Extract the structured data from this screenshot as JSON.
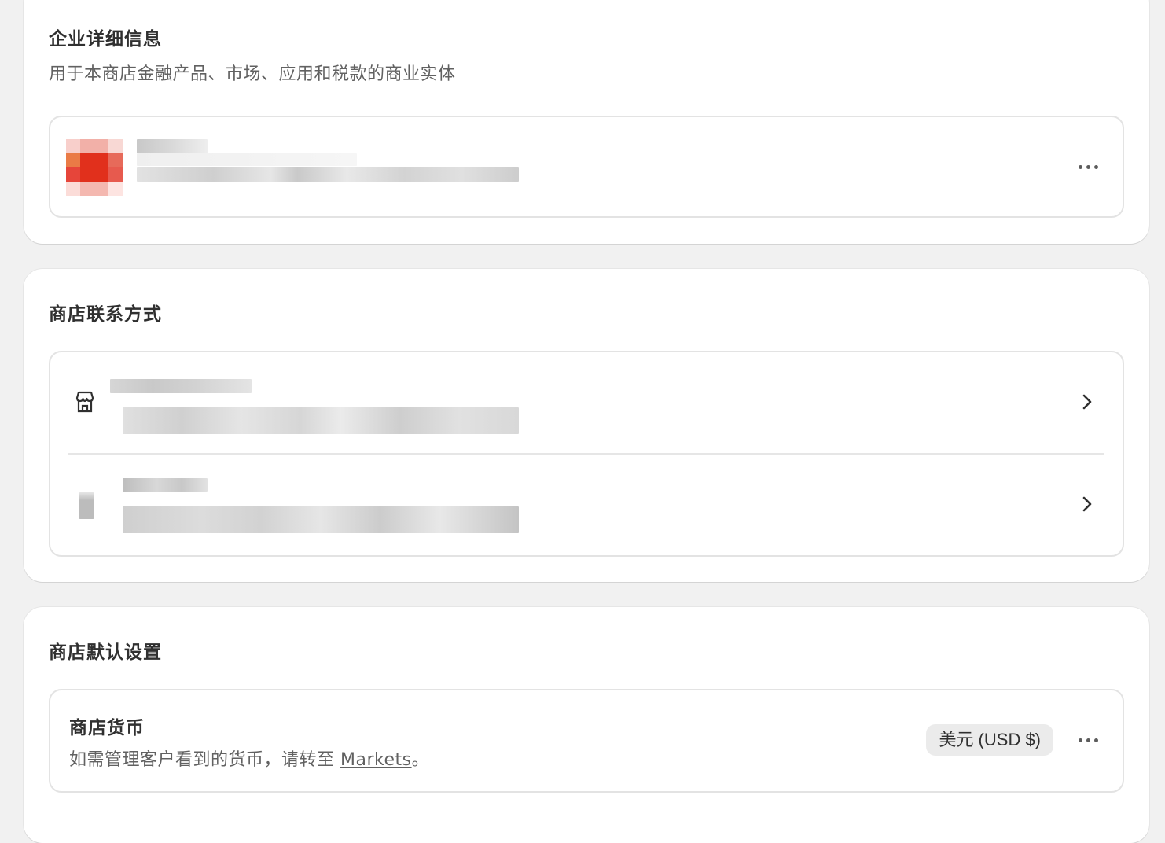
{
  "business_details": {
    "title": "企业详细信息",
    "subtitle": "用于本商店金融产品、市场、应用和税款的商业实体",
    "more_icon": "ellipsis-icon"
  },
  "store_contact": {
    "title": "商店联系方式",
    "rows": [
      {
        "icon": "store-icon",
        "chevron": "chevron-right-icon"
      },
      {
        "icon": "phone-icon",
        "chevron": "chevron-right-icon"
      }
    ]
  },
  "store_defaults": {
    "title": "商店默认设置",
    "currency": {
      "label": "商店货币",
      "desc_prefix": "如需管理客户看到的货币，请转至 ",
      "desc_link": "Markets",
      "desc_suffix": "。",
      "value": "美元 (USD $)",
      "more_icon": "ellipsis-icon"
    }
  },
  "colors": {
    "background": "#f1f1f1",
    "card": "#ffffff",
    "border": "#e3e3e3",
    "badge": "#ebebeb"
  }
}
